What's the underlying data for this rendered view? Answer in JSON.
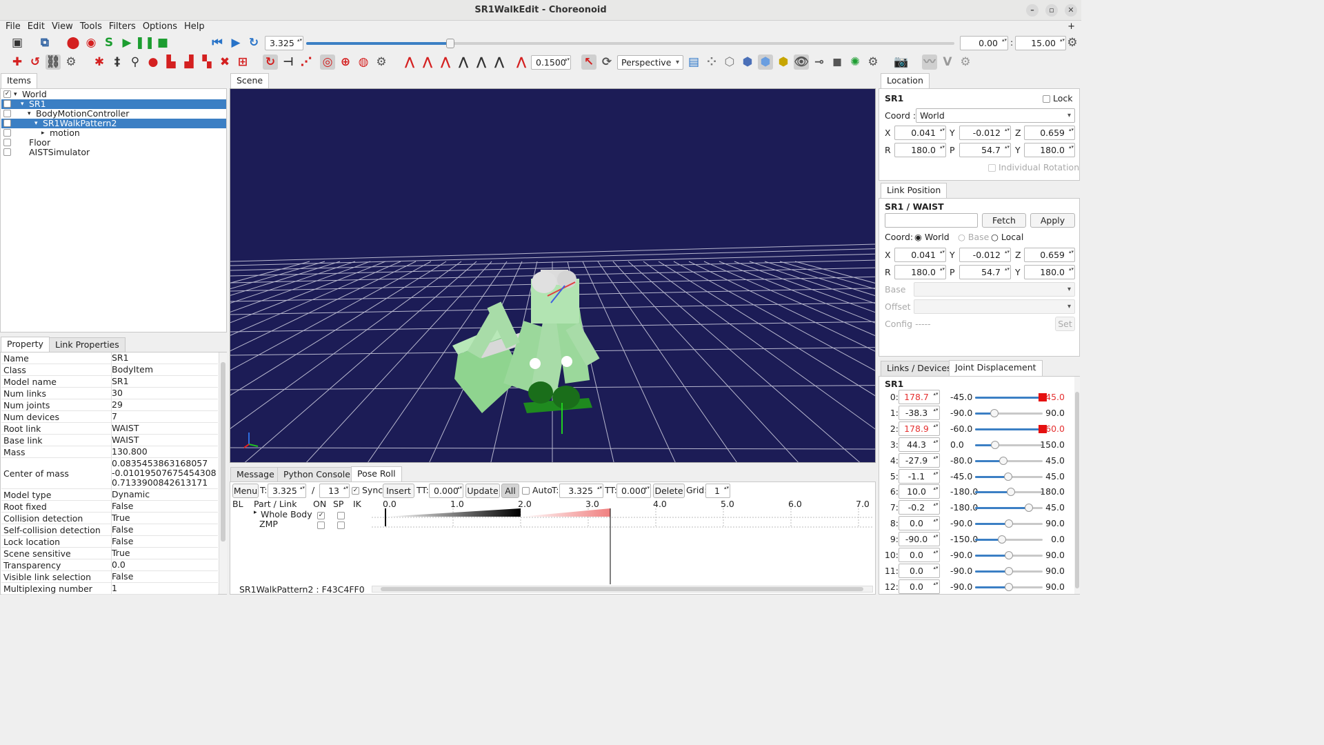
{
  "window": {
    "title": "SR1WalkEdit - Choreonoid"
  },
  "menu": [
    "File",
    "Edit",
    "View",
    "Tools",
    "Filters",
    "Options",
    "Help"
  ],
  "toolbar1": {
    "time": "3.325",
    "time_slider": 0.222,
    "range_start": "0.00",
    "range_end": "15.00"
  },
  "toolbar2": {
    "step": "0.1500",
    "view_mode": "Perspective"
  },
  "items_panel": {
    "tab": "Items",
    "tree": [
      {
        "label": "World",
        "level": 0,
        "checked": true,
        "expanded": true,
        "selected": false
      },
      {
        "label": "SR1",
        "level": 1,
        "checked": true,
        "expanded": true,
        "selected": true
      },
      {
        "label": "BodyMotionController",
        "level": 2,
        "checked": false,
        "expanded": true,
        "selected": false
      },
      {
        "label": "SR1WalkPattern2",
        "level": 3,
        "checked": false,
        "expanded": true,
        "selected": true
      },
      {
        "label": "motion",
        "level": 4,
        "checked": false,
        "expanded": false,
        "selected": false
      },
      {
        "label": "Floor",
        "level": 1,
        "checked": false,
        "expanded": null,
        "selected": false
      },
      {
        "label": "AISTSimulator",
        "level": 1,
        "checked": false,
        "expanded": null,
        "selected": false
      }
    ]
  },
  "property_panel": {
    "tabs": [
      "Property",
      "Link Properties"
    ],
    "rows": [
      {
        "key": "Name",
        "value": "SR1"
      },
      {
        "key": "Class",
        "value": "BodyItem"
      },
      {
        "key": "Model name",
        "value": "SR1"
      },
      {
        "key": "Num links",
        "value": "30"
      },
      {
        "key": "Num joints",
        "value": "29"
      },
      {
        "key": "Num devices",
        "value": "7"
      },
      {
        "key": "Root link",
        "value": "WAIST"
      },
      {
        "key": "Base link",
        "value": "WAIST"
      },
      {
        "key": "Mass",
        "value": "130.800"
      },
      {
        "key": "Center of mass",
        "value": "0.0835453863168057\n-0.01019507675454308\n0.7133900842613171"
      },
      {
        "key": "Model type",
        "value": "Dynamic"
      },
      {
        "key": "Root fixed",
        "value": "False"
      },
      {
        "key": "Collision detection",
        "value": "True"
      },
      {
        "key": "Self-collision detection",
        "value": "False"
      },
      {
        "key": "Lock location",
        "value": "False"
      },
      {
        "key": "Scene sensitive",
        "value": "True"
      },
      {
        "key": "Transparency",
        "value": "0.0"
      },
      {
        "key": "Visible link selection",
        "value": "False"
      },
      {
        "key": "Multiplexing number",
        "value": "1"
      }
    ]
  },
  "scene": {
    "tab": "Scene",
    "bg_color": "#1c1c56"
  },
  "bottom": {
    "tabs": [
      "Message",
      "Python Console",
      "Pose Roll"
    ],
    "pose_roll": {
      "menu": "Menu",
      "t_label": "T:",
      "time": "3.325",
      "slash": "/",
      "total": "13",
      "sync": "Sync",
      "insert": "Insert",
      "tt_label": "TT:",
      "tt": "0.000",
      "update": "Update",
      "all": "All",
      "auto": "Auto",
      "t2_label": "T:",
      "t2": "3.325",
      "tt2_label": "TT:",
      "tt2": "0.000",
      "delete": "Delete",
      "grid_label": "Grid:",
      "grid": "1",
      "headers": [
        "BL",
        "Part / Link",
        "ON",
        "SP",
        "IK"
      ],
      "parts": [
        {
          "name": "Whole Body",
          "on": true
        },
        {
          "name": "ZMP",
          "on": false
        }
      ],
      "ticks": [
        "0.0",
        "1.0",
        "2.0",
        "3.0",
        "4.0",
        "5.0",
        "6.0",
        "7.0"
      ],
      "status": "SR1WalkPattern2 : F43C4FF0"
    }
  },
  "location": {
    "tab": "Location",
    "body": "SR1",
    "lock": "Lock",
    "coord_label": "Coord :",
    "coord": "World",
    "x": "0.041",
    "y": "-0.012",
    "z": "0.659",
    "r": "180.0",
    "p": "54.7",
    "yaw": "180.0",
    "individual": "Individual Rotation"
  },
  "link_position": {
    "tab": "Link Position",
    "target": "SR1 / WAIST",
    "fetch": "Fetch",
    "apply": "Apply",
    "coord_label": "Coord:",
    "coords": [
      "World",
      "Base",
      "Local"
    ],
    "x": "0.041",
    "y": "-0.012",
    "z": "0.659",
    "r": "180.0",
    "p": "54.7",
    "yaw": "180.0",
    "base": "Base",
    "offset": "Offset",
    "config": "Config",
    "config_val": "-----",
    "set": "Set"
  },
  "joints_panel": {
    "tabs": [
      "Links / Devices",
      "Joint Displacement"
    ],
    "body": "SR1",
    "joints": [
      {
        "id": "0:",
        "value": "178.7",
        "min": "-45.0",
        "max": "45.0",
        "pos": 1.0,
        "limit": true
      },
      {
        "id": "1:",
        "value": "-38.3",
        "min": "-90.0",
        "max": "90.0",
        "pos": 0.287,
        "limit": false
      },
      {
        "id": "2:",
        "value": "178.9",
        "min": "-60.0",
        "max": "60.0",
        "pos": 1.0,
        "limit": true
      },
      {
        "id": "3:",
        "value": "44.3",
        "min": "0.0",
        "max": "150.0",
        "pos": 0.295,
        "limit": false
      },
      {
        "id": "4:",
        "value": "-27.9",
        "min": "-80.0",
        "max": "45.0",
        "pos": 0.417,
        "limit": false
      },
      {
        "id": "5:",
        "value": "-1.1",
        "min": "-45.0",
        "max": "45.0",
        "pos": 0.488,
        "limit": false
      },
      {
        "id": "6:",
        "value": "10.0",
        "min": "-180.0",
        "max": "180.0",
        "pos": 0.528,
        "limit": false
      },
      {
        "id": "7:",
        "value": "-0.2",
        "min": "-180.0",
        "max": "45.0",
        "pos": 0.799,
        "limit": false
      },
      {
        "id": "8:",
        "value": "0.0",
        "min": "-90.0",
        "max": "90.0",
        "pos": 0.5,
        "limit": false
      },
      {
        "id": "9:",
        "value": "-90.0",
        "min": "-150.0",
        "max": "0.0",
        "pos": 0.4,
        "limit": false
      },
      {
        "id": "10:",
        "value": "0.0",
        "min": "-90.0",
        "max": "90.0",
        "pos": 0.5,
        "limit": false
      },
      {
        "id": "11:",
        "value": "0.0",
        "min": "-90.0",
        "max": "90.0",
        "pos": 0.5,
        "limit": false
      },
      {
        "id": "12:",
        "value": "0.0",
        "min": "-90.0",
        "max": "90.0",
        "pos": 0.5,
        "limit": false
      }
    ]
  }
}
